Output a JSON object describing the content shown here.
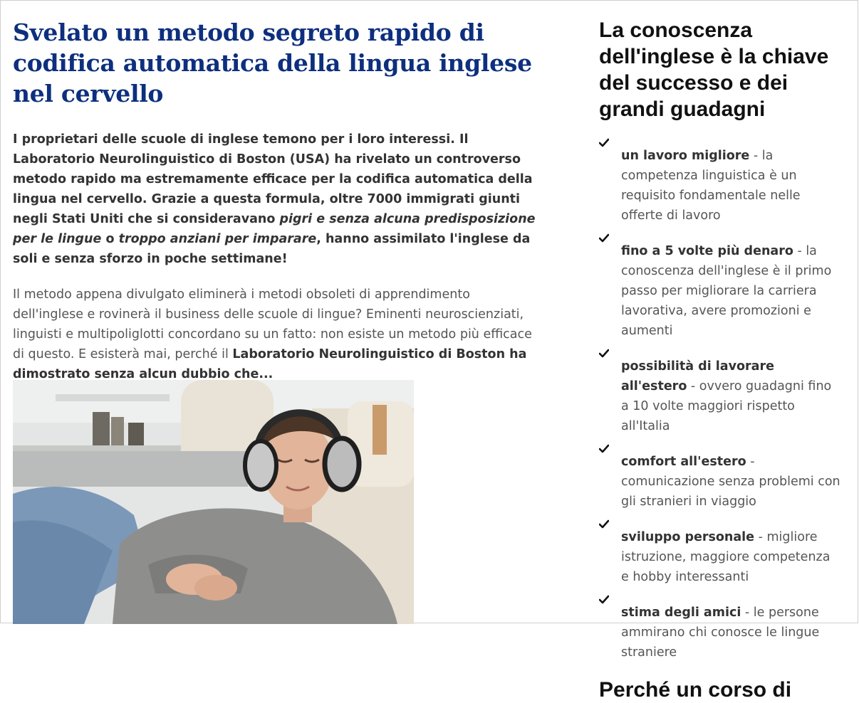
{
  "article": {
    "title": "Svelato un metodo segreto rapido di codifica automatica della lingua inglese nel cervello",
    "lead": {
      "part1": "I proprietari delle scuole di inglese temono per i loro interessi. Il Laboratorio Neurolinguistico di Boston (USA) ha rivelato un controverso metodo rapido ma estremamente efficace per la codifica automatica della lingua nel cervello. Grazie a questa formula, oltre 7000 immigrati giunti negli Stati Uniti che si consideravano ",
      "italic1": "pigri e senza alcuna predisposizione per le lingue",
      "part2": " o ",
      "italic2": "troppo anziani per imparare",
      "part3": ", hanno assimilato l'inglese da soli e senza sforzo in poche settimane!"
    },
    "body": {
      "text": "Il metodo appena divulgato eliminerà i metodi obsoleti di apprendimento dell'inglese e rovinerà il business delle scuole di lingue? Eminenti neuroscienziati, linguisti e multipoliglotti concordano su un fatto: non esiste un metodo più efficace di questo. E esisterà mai, perché il ",
      "bold": "Laboratorio Neurolinguistico di Boston ha dimostrato senza alcun dubbio che..."
    }
  },
  "sidebar": {
    "title": "La conoscenza dell'inglese è la chiave del successo e dei grandi guadagni",
    "items": [
      {
        "bold": "un lavoro migliore",
        "text": " - la competenza linguistica è un requisito fondamentale nelle offerte di lavoro"
      },
      {
        "bold": "fino a 5 volte più denaro",
        "text": " - la conoscenza dell'inglese è il primo passo per migliorare la carriera lavorativa, avere promozioni e aumenti"
      },
      {
        "bold": "possibilità di lavorare all'estero",
        "text": " - ovvero guadagni fino a 10 volte maggiori rispetto all'Italia"
      },
      {
        "bold": "comfort all'estero",
        "text": " - comunicazione senza problemi con gli stranieri in viaggio"
      },
      {
        "bold": "sviluppo personale",
        "text": " - migliore istruzione, maggiore competenza e hobby interessanti"
      },
      {
        "bold": "stima degli amici",
        "text": " - le persone ammirano chi conosce le lingue straniere"
      }
    ],
    "title2": "Perché un corso di"
  },
  "colors": {
    "title_blue": "#0d2f7e",
    "text_dark": "#333333",
    "text_muted": "#555555"
  }
}
